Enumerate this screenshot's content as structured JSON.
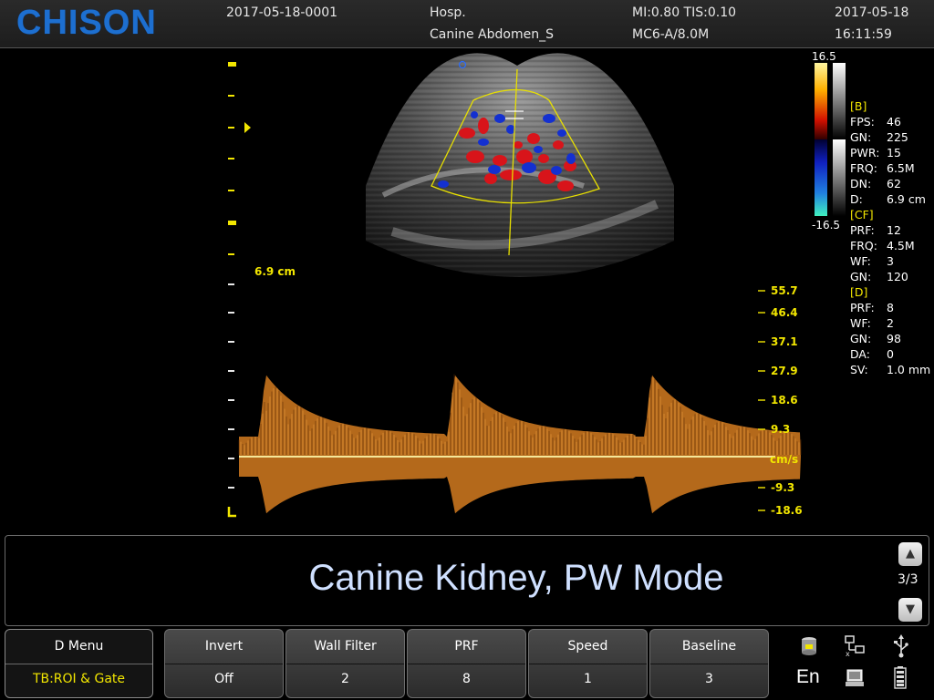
{
  "header": {
    "brand": "CHISON",
    "patient_id": "2017-05-18-0001",
    "hospital": "Hosp.",
    "exam_preset": "Canine Abdomen_S",
    "mi_tis": "MI:0.80  TIS:0.10",
    "probe": "MC6-A/8.0M",
    "date": "2017-05-18",
    "time": "16:11:59"
  },
  "image": {
    "depth_label": "6.9 cm",
    "color_bar_max": "16.5",
    "color_bar_min": "-16.5",
    "doppler_unit": "cm/s",
    "velocity_scale": [
      "55.7",
      "46.4",
      "37.1",
      "27.9",
      "18.6",
      "9.3",
      "-9.3",
      "-18.6"
    ],
    "colors": {
      "sector_outline": "#e8e000",
      "doppler_flow_red": "#d8141a",
      "doppler_flow_blue": "#1430d0",
      "spectrum": "#c8741e",
      "marker_yellow": "#f2e600"
    }
  },
  "params": [
    {
      "key": "[B]",
      "value": "",
      "section": true
    },
    {
      "key": "FPS:",
      "value": "46"
    },
    {
      "key": "GN:",
      "value": "225"
    },
    {
      "key": "PWR:",
      "value": "15"
    },
    {
      "key": "FRQ:",
      "value": "6.5M"
    },
    {
      "key": "DN:",
      "value": "62"
    },
    {
      "key": "D:",
      "value": "6.9 cm"
    },
    {
      "key": "[CF]",
      "value": "",
      "section": true
    },
    {
      "key": "PRF:",
      "value": "12"
    },
    {
      "key": "FRQ:",
      "value": "4.5M"
    },
    {
      "key": "WF:",
      "value": "3"
    },
    {
      "key": "GN:",
      "value": "120"
    },
    {
      "key": "[D]",
      "value": "",
      "section": true
    },
    {
      "key": "PRF:",
      "value": "8"
    },
    {
      "key": "WF:",
      "value": "2"
    },
    {
      "key": "GN:",
      "value": "98"
    },
    {
      "key": "DA:",
      "value": "0"
    },
    {
      "key": "SV:",
      "value": "1.0 mm"
    }
  ],
  "comment": {
    "text": "Canine Kidney, PW Mode",
    "page": "3/3"
  },
  "menu": {
    "title": "D Menu",
    "mode": "TB:ROI & Gate"
  },
  "softkeys": [
    {
      "label": "Invert",
      "value": "Off"
    },
    {
      "label": "Wall Filter",
      "value": "2"
    },
    {
      "label": "PRF",
      "value": "8"
    },
    {
      "label": "Speed",
      "value": "1"
    },
    {
      "label": "Baseline",
      "value": "3"
    }
  ],
  "status": {
    "language": "En",
    "icons": [
      "database-icon",
      "network-icon",
      "usb-icon",
      "printer-icon",
      "battery-icon"
    ]
  }
}
